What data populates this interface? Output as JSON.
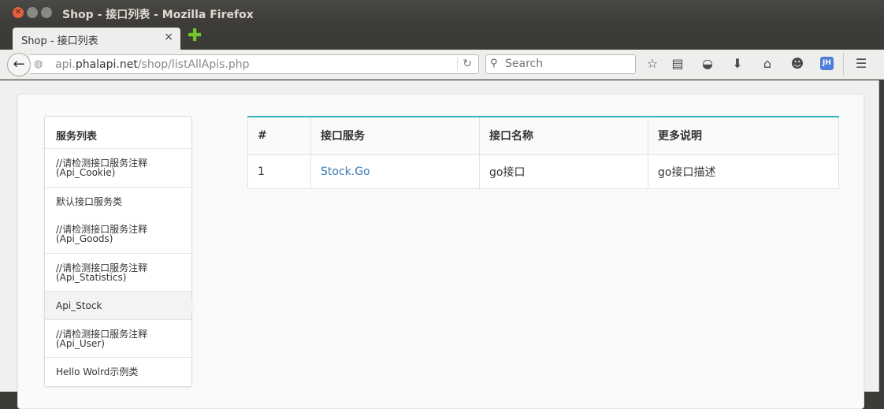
{
  "window": {
    "title": "Shop - 接口列表 - Mozilla Firefox"
  },
  "tab": {
    "title": "Shop - 接口列表",
    "close_glyph": "×",
    "new_tab_glyph": "✚"
  },
  "toolbar": {
    "url_prefix": "api.",
    "url_domain": "phalapi.net",
    "url_path": "/shop/listAllApis.php",
    "search_placeholder": "Search",
    "jh_badge": "JH"
  },
  "sidebar": {
    "heading": "服务列表",
    "items": [
      {
        "line1": "//请检测接口服务注释",
        "line2": "(Api_Cookie)",
        "active": false
      },
      {
        "line1": "默认接口服务类",
        "line2": "",
        "active": false
      },
      {
        "line1": "//请检测接口服务注释",
        "line2": "(Api_Goods)",
        "active": false
      },
      {
        "line1": "//请检测接口服务注释",
        "line2": "(Api_Statistics)",
        "active": false
      },
      {
        "line1": "Api_Stock",
        "line2": "",
        "active": true
      },
      {
        "line1": "//请检测接口服务注释",
        "line2": "(Api_User)",
        "active": false
      },
      {
        "line1": "Hello Wolrd示例类",
        "line2": "",
        "active": false
      }
    ]
  },
  "table": {
    "headers": [
      "#",
      "接口服务",
      "接口名称",
      "更多说明"
    ],
    "rows": [
      {
        "num": "1",
        "service": "Stock.Go",
        "name": "go接口",
        "desc": "go接口描述"
      }
    ]
  },
  "colors": {
    "table_accent": "#2fb3c0",
    "link": "#3a7ab5"
  }
}
